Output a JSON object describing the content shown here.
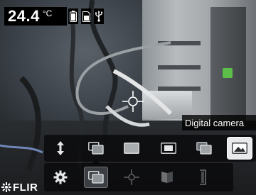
{
  "readout": {
    "temperature_value": "24.4",
    "temperature_unit": "°C",
    "status_icons": [
      "battery-icon",
      "sd-card-icon",
      "usb-icon"
    ]
  },
  "tooltip": {
    "text": "Digital camera"
  },
  "logo": {
    "text": "FLIR"
  },
  "image_mode_menu": {
    "items": [
      {
        "name": "flip-arrows-icon",
        "state": "normal"
      },
      {
        "name": "picture-in-picture-icon",
        "state": "normal"
      },
      {
        "name": "thermal-full-icon",
        "state": "normal"
      },
      {
        "name": "msx-blend-icon",
        "state": "normal"
      },
      {
        "name": "thermal-fusion-icon",
        "state": "normal"
      },
      {
        "name": "digital-camera-icon",
        "state": "active"
      }
    ]
  },
  "main_menu": {
    "items": [
      {
        "name": "settings-gear-icon",
        "state": "normal"
      },
      {
        "name": "image-mode-icon",
        "state": "selected"
      },
      {
        "name": "measurement-spot-icon",
        "state": "dim"
      },
      {
        "name": "color-palette-icon",
        "state": "dim"
      },
      {
        "name": "temperature-scale-icon",
        "state": "dim"
      }
    ]
  },
  "colors": {
    "menu_bg": "#0a0a0c",
    "active_button": "#e8eaeb",
    "selected_button": "#3b3f43",
    "hud_text": "#ffffff",
    "status_led": "#5bbf4a"
  }
}
